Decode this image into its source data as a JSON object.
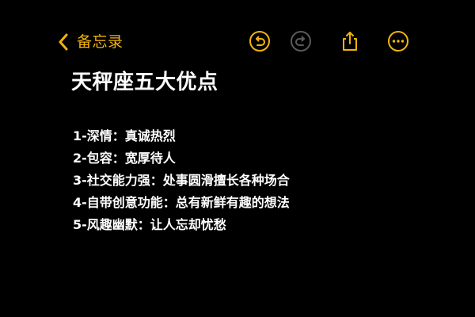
{
  "colors": {
    "background": "#000000",
    "accent": "#F2B30F",
    "accent_disabled": "#5A5A5A",
    "text": "#FFFFFF"
  },
  "toolbar": {
    "back_label": "备忘录",
    "icons": [
      "chevron-left-icon",
      "undo-icon",
      "redo-icon",
      "share-icon",
      "more-icon"
    ]
  },
  "note": {
    "title": "天秤座五大优点",
    "items": [
      "1-深情：真诚热烈",
      "2-包容：宽厚待人",
      "3-社交能力强：处事圆滑擅长各种场合",
      "4-自带创意功能：总有新鲜有趣的想法",
      "5-风趣幽默：让人忘却忧愁"
    ]
  }
}
